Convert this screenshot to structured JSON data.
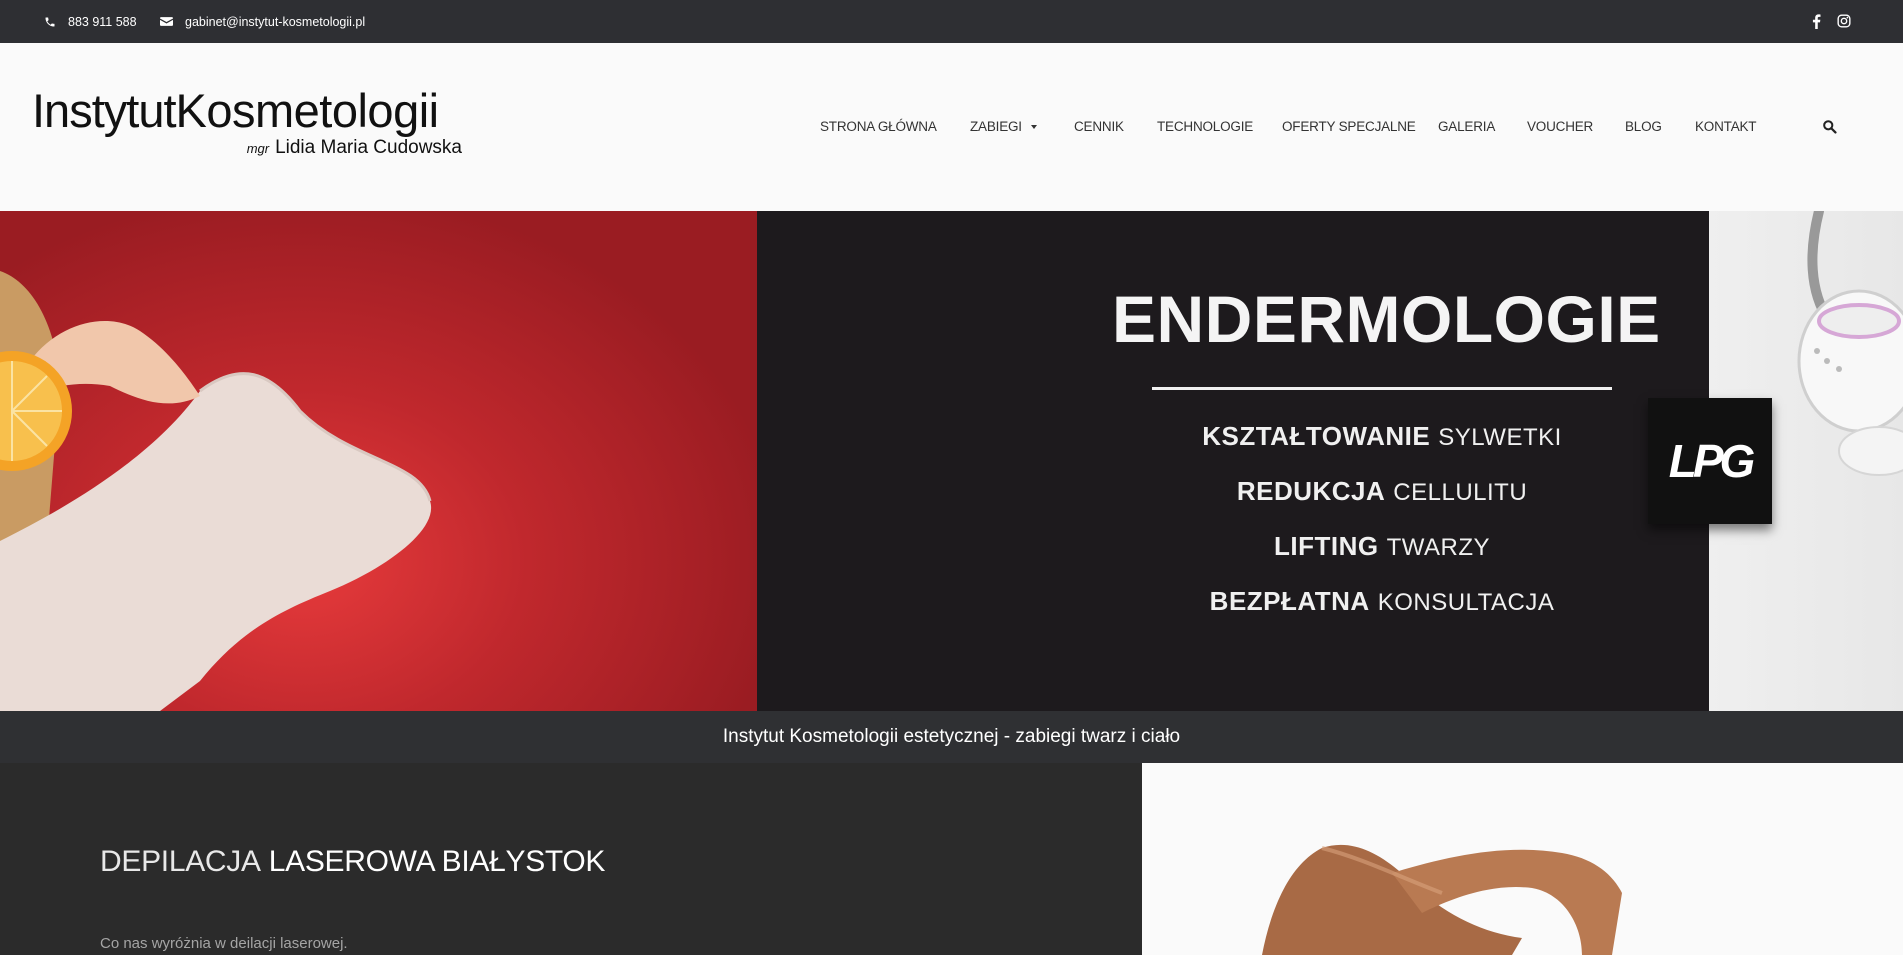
{
  "topbar": {
    "phone": "883 911 588",
    "email": "gabinet@instytut-kosmetologii.pl",
    "social": [
      "facebook-icon",
      "instagram-icon"
    ]
  },
  "logo": {
    "word1": "Instytut",
    "word2": "Kosmetologii",
    "prefix": "mgr",
    "name": "Lidia Maria Cudowska"
  },
  "nav": {
    "items": [
      {
        "label": "STRONA GŁÓWNA"
      },
      {
        "label": "ZABIEGI"
      },
      {
        "label": "CENNIK"
      },
      {
        "label": "TECHNOLOGIE"
      },
      {
        "label": "OFERTY SPECJALNE"
      },
      {
        "label": "GALERIA"
      },
      {
        "label": "VOUCHER"
      },
      {
        "label": "BLOG"
      },
      {
        "label": "KONTAKT"
      }
    ]
  },
  "hero": {
    "title": "ENDERMOLOGIE",
    "lines": [
      {
        "bold": "KSZTAŁTOWANIE",
        "light": "SYLWETKI"
      },
      {
        "bold": "REDUKCJA",
        "light": "CELLULITU"
      },
      {
        "bold": "LIFTING",
        "light": "TWARZY"
      },
      {
        "bold": "BEZPŁATNA",
        "light": "KONSULTACJA"
      }
    ],
    "badge": "LPG",
    "colors": {
      "left": "#9a1c22",
      "center": "#1d1a1d"
    }
  },
  "tagline": "Instytut Kosmetologii estetycznej - zabiegi twarz i ciało",
  "section": {
    "title_light": "DEPILACJA",
    "title_bold": "LASEROWA BIAŁYSTOK",
    "text": "Co nas wyróżnia w deilacji laserowej."
  }
}
